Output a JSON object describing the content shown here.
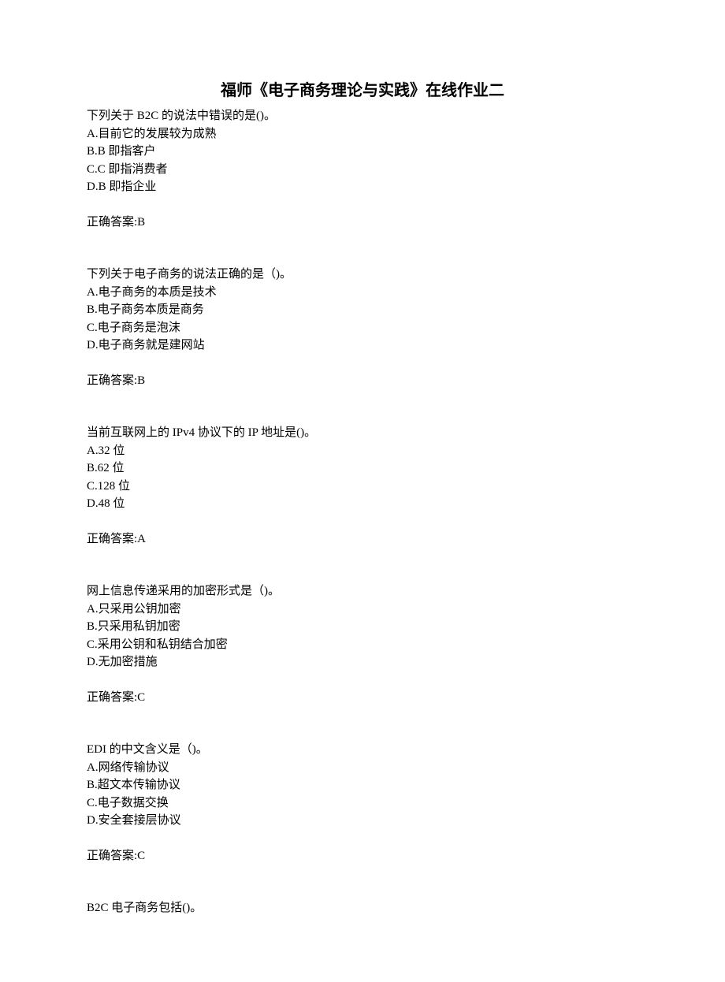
{
  "title": "福师《电子商务理论与实践》在线作业二",
  "questions": [
    {
      "stem": "下列关于 B2C 的说法中错误的是()。",
      "options": [
        "A.目前它的发展较为成熟",
        "B.B 即指客户",
        "C.C 即指消费者",
        "D.B 即指企业"
      ],
      "answer": "正确答案:B"
    },
    {
      "stem": "下列关于电子商务的说法正确的是（)。",
      "options": [
        "A.电子商务的本质是技术",
        "B.电子商务本质是商务",
        "C.电子商务是泡沫",
        "D.电子商务就是建网站"
      ],
      "answer": "正确答案:B"
    },
    {
      "stem": "当前互联网上的 IPv4 协议下的 IP 地址是()。",
      "options": [
        "A.32 位",
        "B.62 位",
        "C.128 位",
        "D.48 位"
      ],
      "answer": "正确答案:A"
    },
    {
      "stem": "网上信息传递采用的加密形式是（)。",
      "options": [
        "A.只采用公钥加密",
        "B.只采用私钥加密",
        "C.采用公钥和私钥结合加密",
        "D.无加密措施"
      ],
      "answer": "正确答案:C"
    },
    {
      "stem": "EDI 的中文含义是（)。",
      "options": [
        "A.网络传输协议",
        "B.超文本传输协议",
        "C.电子数据交换",
        "D.安全套接层协议"
      ],
      "answer": "正确答案:C"
    },
    {
      "stem": "B2C 电子商务包括()。",
      "options": [],
      "answer": ""
    }
  ]
}
